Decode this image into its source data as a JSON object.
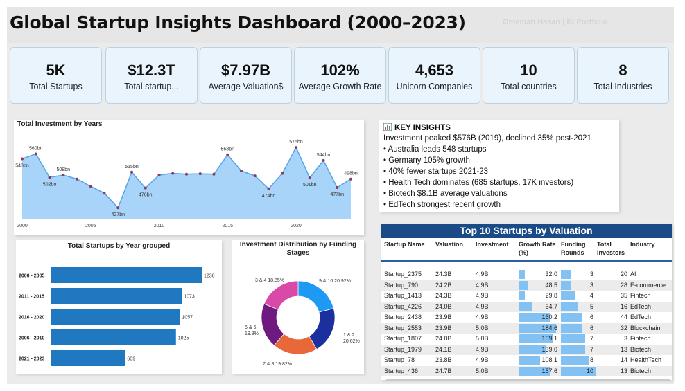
{
  "header": {
    "title": "Global Startup Insights Dashboard (2000–2023)",
    "author": "Omemah Hasan | BI Portfolio"
  },
  "kpis": [
    {
      "value": "5K",
      "label": "Total Startups"
    },
    {
      "value": "$12.3T",
      "label": "Total startup..."
    },
    {
      "value": "$7.97B",
      "label": "Average Valuation$"
    },
    {
      "value": "102%",
      "label": "Average Growth Rate"
    },
    {
      "value": "4,653",
      "label": "Unicorn Companies"
    },
    {
      "value": "10",
      "label": "Total countries"
    },
    {
      "value": "8",
      "label": "Total Industries"
    }
  ],
  "insights": {
    "title": "KEY INSIGHTS",
    "lead": "Investment peaked $576B (2019), declined 35% post-2021",
    "bullets": [
      "Australia leads 548 startups",
      "Germany 105% growth",
      "40% fewer startups 2021-23",
      "Health Tech dominates (685 startups, 17K investors)",
      "Biotech $8.1B average valuations",
      "EdTech strongest recent growth"
    ]
  },
  "charts": {
    "area_title": "Total Investment by Years",
    "bar_title": "Total Startups by Year grouped",
    "donut_title": "Investment Distribution by Funding Stages"
  },
  "chart_data": [
    {
      "type": "area",
      "title": "Total Investment by Years",
      "x": [
        2000,
        2001,
        2002,
        2003,
        2004,
        2005,
        2006,
        2007,
        2008,
        2009,
        2010,
        2011,
        2012,
        2013,
        2014,
        2015,
        2016,
        2017,
        2018,
        2019,
        2020,
        2021,
        2022,
        2023
      ],
      "y": [
        548,
        560,
        502,
        508,
        498,
        480,
        463,
        427,
        515,
        476,
        508,
        512,
        510,
        511,
        510,
        558,
        518,
        506,
        474,
        512,
        576,
        501,
        544,
        477,
        498
      ],
      "x_labels_years": [
        2000,
        2001,
        2002,
        2003,
        2004,
        2005,
        2006,
        2007,
        2008,
        2009,
        2010,
        2011,
        2012,
        2013,
        2014,
        2015,
        2016,
        2017,
        2018,
        2019,
        2020,
        2021,
        2022,
        2023,
        2024
      ],
      "point_labels": [
        {
          "index": 0,
          "text": "548bn"
        },
        {
          "index": 1,
          "text": "560bn"
        },
        {
          "index": 2,
          "text": "502bn"
        },
        {
          "index": 3,
          "text": "508bn"
        },
        {
          "index": 7,
          "text": "427bn"
        },
        {
          "index": 8,
          "text": "515bn"
        },
        {
          "index": 9,
          "text": "476bn"
        },
        {
          "index": 15,
          "text": "558bn"
        },
        {
          "index": 18,
          "text": "474bn"
        },
        {
          "index": 20,
          "text": "576bn"
        },
        {
          "index": 21,
          "text": "501bn"
        },
        {
          "index": 22,
          "text": "544bn"
        },
        {
          "index": 23,
          "text": "477bn"
        },
        {
          "index": 24,
          "text": "498bn"
        }
      ],
      "x_ticks": [
        "2000",
        "2005",
        "2010",
        "2015",
        "2020"
      ],
      "ylim": [
        400,
        600
      ],
      "color": "#99cdf8",
      "line_color": "#5aa6ea",
      "marker_color": "#8a3c5c"
    },
    {
      "type": "bar",
      "orientation": "horizontal",
      "title": "Total Startups by Year grouped",
      "categories": [
        "2000 - 2005",
        "2011 - 2015",
        "2016 - 2020",
        "2006 - 2010",
        "2021 - 2023"
      ],
      "values": [
        1236,
        1073,
        1057,
        1025,
        609
      ],
      "xlim": [
        0,
        1236
      ],
      "color": "#1f78c0"
    },
    {
      "type": "pie",
      "donut": true,
      "title": "Investment Distribution by Funding Stages",
      "slices": [
        {
          "label": "9 & 10",
          "value": 20.92,
          "text": "9 & 10 20.92%",
          "color": "#1e9af5"
        },
        {
          "label": "1 & 2",
          "value": 20.62,
          "text": "1 & 2\n20.62%",
          "color": "#1c2f9e"
        },
        {
          "label": "7 & 8",
          "value": 19.82,
          "text": "7 & 8 19.82%",
          "color": "#e8683a"
        },
        {
          "label": "5 & 6",
          "value": 19.8,
          "text": "5 & 6\n19.8%",
          "color": "#6e1a7e"
        },
        {
          "label": "3 & 4",
          "value": 18.85,
          "text": "3 & 4 18.85%",
          "color": "#d94aa8"
        }
      ]
    },
    {
      "type": "table",
      "title": "Top 10 Startups by Valuation",
      "columns": [
        "Startup Name",
        "Valuation",
        "Investment",
        "Growth Rate (%)",
        "Funding Rounds",
        "Total Investors",
        "Industry"
      ],
      "rows": [
        [
          "Startup_2375",
          "24.3B",
          "4.9B",
          32.0,
          3,
          20,
          "AI"
        ],
        [
          "Startup_790",
          "24.2B",
          "4.9B",
          48.5,
          3,
          28,
          "E-commerce"
        ],
        [
          "Startup_1413",
          "24.3B",
          "4.9B",
          29.8,
          4,
          35,
          "Fintech"
        ],
        [
          "Startup_4226",
          "24.0B",
          "4.9B",
          64.7,
          5,
          16,
          "EdTech"
        ],
        [
          "Startup_2438",
          "23.9B",
          "4.9B",
          160.2,
          6,
          44,
          "EdTech"
        ],
        [
          "Startup_2553",
          "23.9B",
          "5.0B",
          184.6,
          6,
          32,
          "Blockchain"
        ],
        [
          "Startup_1807",
          "24.0B",
          "5.0B",
          169.1,
          7,
          3,
          "Fintech"
        ],
        [
          "Startup_1979",
          "24.1B",
          "4.9B",
          139.0,
          7,
          13,
          "Biotech"
        ],
        [
          "Startup_78",
          "23.8B",
          "4.9B",
          108.1,
          8,
          14,
          "HealthTech"
        ],
        [
          "Startup_436",
          "24.7B",
          "5.0B",
          157.6,
          10,
          13,
          "Biotech"
        ]
      ],
      "growth_max": 200,
      "rounds_max": 10
    }
  ],
  "table": {
    "title": "Top 10 Startups by Valuation",
    "headers": [
      "Startup Name",
      "Valuation",
      "Investment",
      "Growth Rate\n(%)",
      "Funding\nRounds",
      "Total\nInvestors",
      "Industry"
    ],
    "growth_labels": [
      "32.0",
      "48.5",
      "29.8",
      "64.7",
      "160.2",
      "184.6",
      "169.1",
      "139.0",
      "108.1",
      "157.6"
    ]
  }
}
